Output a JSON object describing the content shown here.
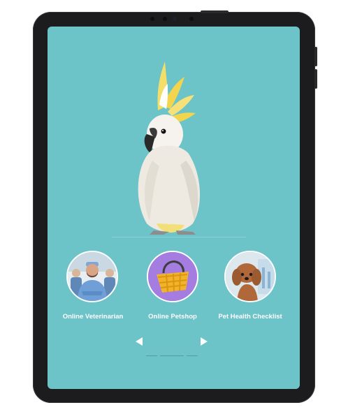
{
  "categories": [
    {
      "label": "Online Veterinarian",
      "icon": "veterinarian-photo"
    },
    {
      "label": "Online Petshop",
      "icon": "shopping-basket-icon"
    },
    {
      "label": "Pet Health Checklist",
      "icon": "dog-photo"
    }
  ],
  "hero": {
    "image": "cockatoo-photo"
  },
  "carousel": {
    "prev": "prev-arrow-icon",
    "next": "next-arrow-icon",
    "pages": 3,
    "active_page": 2
  },
  "colors": {
    "screen_bg": "#6cc3c8",
    "bezel": "#1c1c1e",
    "petshop_bg": "#a57de0",
    "basket": "#f2b32a"
  }
}
